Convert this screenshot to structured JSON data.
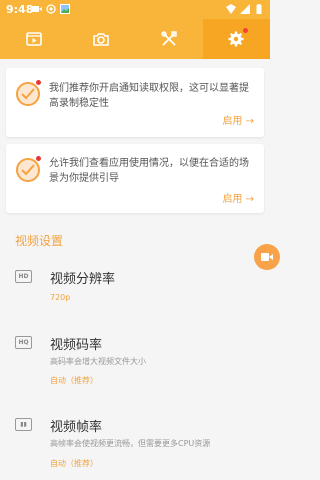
{
  "status": {
    "time": "9:48"
  },
  "tabs": [
    {
      "name": "video-icon"
    },
    {
      "name": "camera-icon"
    },
    {
      "name": "tools-icon"
    },
    {
      "name": "settings-icon"
    }
  ],
  "cards": [
    {
      "message": "我们推荐你开启通知读取权限，这可以显著提高录制稳定性",
      "action": "启用 →"
    },
    {
      "message": "允许我们查看应用使用情况，以便在合适的场景为你提供引导",
      "action": "启用 →"
    }
  ],
  "section": {
    "title": "视频设置"
  },
  "settings": [
    {
      "icon": "HD",
      "title": "视频分辨率",
      "description": "",
      "value": "720p"
    },
    {
      "icon": "HQ",
      "title": "视频码率",
      "description": "高码率会增大视频文件大小",
      "value": "自动（推荐）"
    },
    {
      "icon": "▮▮",
      "title": "视频帧率",
      "description": "高帧率会使视频更流畅，但需要更多CPU资源",
      "value": "自动（推荐）"
    }
  ],
  "colors": {
    "accent": "#f8b53a",
    "link": "#f4a340"
  }
}
